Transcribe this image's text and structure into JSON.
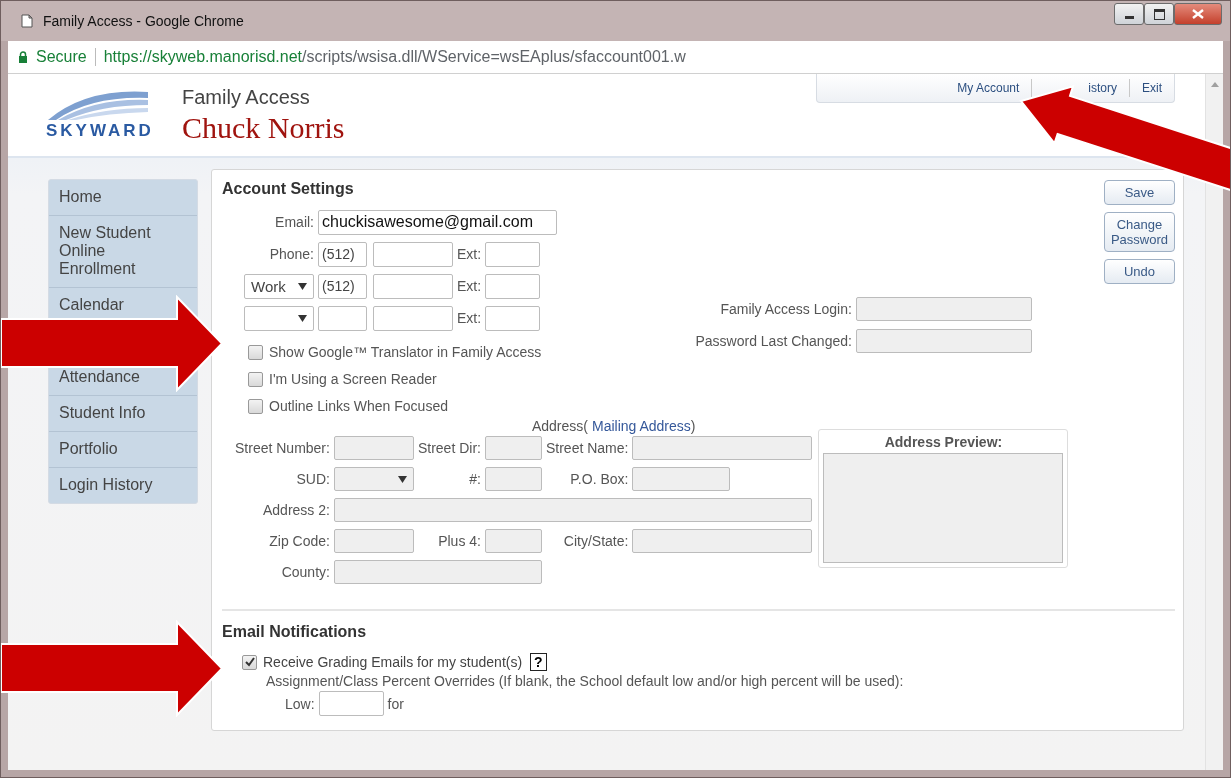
{
  "window": {
    "title": "Family Access - Google Chrome"
  },
  "address_bar": {
    "secure_label": "Secure",
    "url_host": "https://skyweb.manorisd.net",
    "url_path": "/scripts/wsisa.dll/WService=wsEAplus/sfaccount001.w"
  },
  "header": {
    "logo_text": "SKYWARD",
    "app_name": "Family Access",
    "user_name": "Chuck Norris",
    "links": [
      {
        "label": "My Account"
      },
      {
        "label": "istory"
      },
      {
        "label": "Exit"
      }
    ]
  },
  "sidebar": {
    "items": [
      {
        "kind": "link",
        "label": "Home"
      },
      {
        "kind": "link",
        "label": "New Student Online Enrollment"
      },
      {
        "kind": "link",
        "label": "Calendar"
      },
      {
        "kind": "covered"
      },
      {
        "kind": "link",
        "label": "Attendance"
      },
      {
        "kind": "link",
        "label": "Student Info"
      },
      {
        "kind": "link",
        "label": "Portfolio"
      },
      {
        "kind": "link",
        "label": "Login History"
      }
    ]
  },
  "account_settings": {
    "title": "Account Settings",
    "email": {
      "label": "Email:",
      "value": "chuckisawesome@gmail.com"
    },
    "phones": [
      {
        "kind": "label",
        "label": "Phone:",
        "area": "(512)",
        "ext_label": "Ext:"
      },
      {
        "kind": "select",
        "type": "Work",
        "area": "(512)",
        "ext_label": "Ext:"
      },
      {
        "kind": "select",
        "ext_label": "Ext:"
      }
    ],
    "checkboxes": [
      {
        "label": "Show Google™ Translator in Family Access",
        "checked": false
      },
      {
        "label": "I'm Using a Screen Reader",
        "checked": false
      },
      {
        "label": "Outline Links When Focused",
        "checked": false
      }
    ],
    "login_fields": [
      {
        "label": "Family Access Login:"
      },
      {
        "label": "Password Last Changed:"
      }
    ],
    "buttons": [
      {
        "label": "Save"
      },
      {
        "label": "Change Password"
      },
      {
        "label": "Undo"
      }
    ]
  },
  "address": {
    "title": "Address",
    "paren_open": "(",
    "link": "Mailing Address",
    "paren_close": ")",
    "preview_title": "Address Preview:",
    "rows": [
      [
        {
          "label": "Street Number:",
          "kind": "text"
        },
        {
          "label": "Street Dir:",
          "kind": "text"
        },
        {
          "label": "Street Name:",
          "kind": "text"
        }
      ],
      [
        {
          "label": "SUD:",
          "kind": "select"
        },
        {
          "label": "#:",
          "kind": "text"
        },
        {
          "label": "P.O. Box:",
          "kind": "short"
        }
      ],
      [
        {
          "label": "Address 2:",
          "kind": "wide"
        }
      ],
      [
        {
          "label": "Zip Code:",
          "kind": "text"
        },
        {
          "label": "Plus 4:",
          "kind": "text"
        },
        {
          "label": "City/State:",
          "kind": "text"
        }
      ],
      [
        {
          "label": "County:",
          "kind": "medium"
        }
      ]
    ]
  },
  "email_notifications": {
    "title": "Email Notifications",
    "checkbox": {
      "label": "Receive Grading Emails for my student(s)",
      "checked": true
    },
    "help": "?",
    "overrides_text": "Assignment/Class Percent Overrides (If blank, the School default low and/or high percent will be used):",
    "low_label": "Low:",
    "for_label": "for"
  },
  "annotations": [
    {
      "kind": "arrow_up_left"
    },
    {
      "kind": "arrow_right"
    },
    {
      "kind": "arrow_right"
    }
  ]
}
